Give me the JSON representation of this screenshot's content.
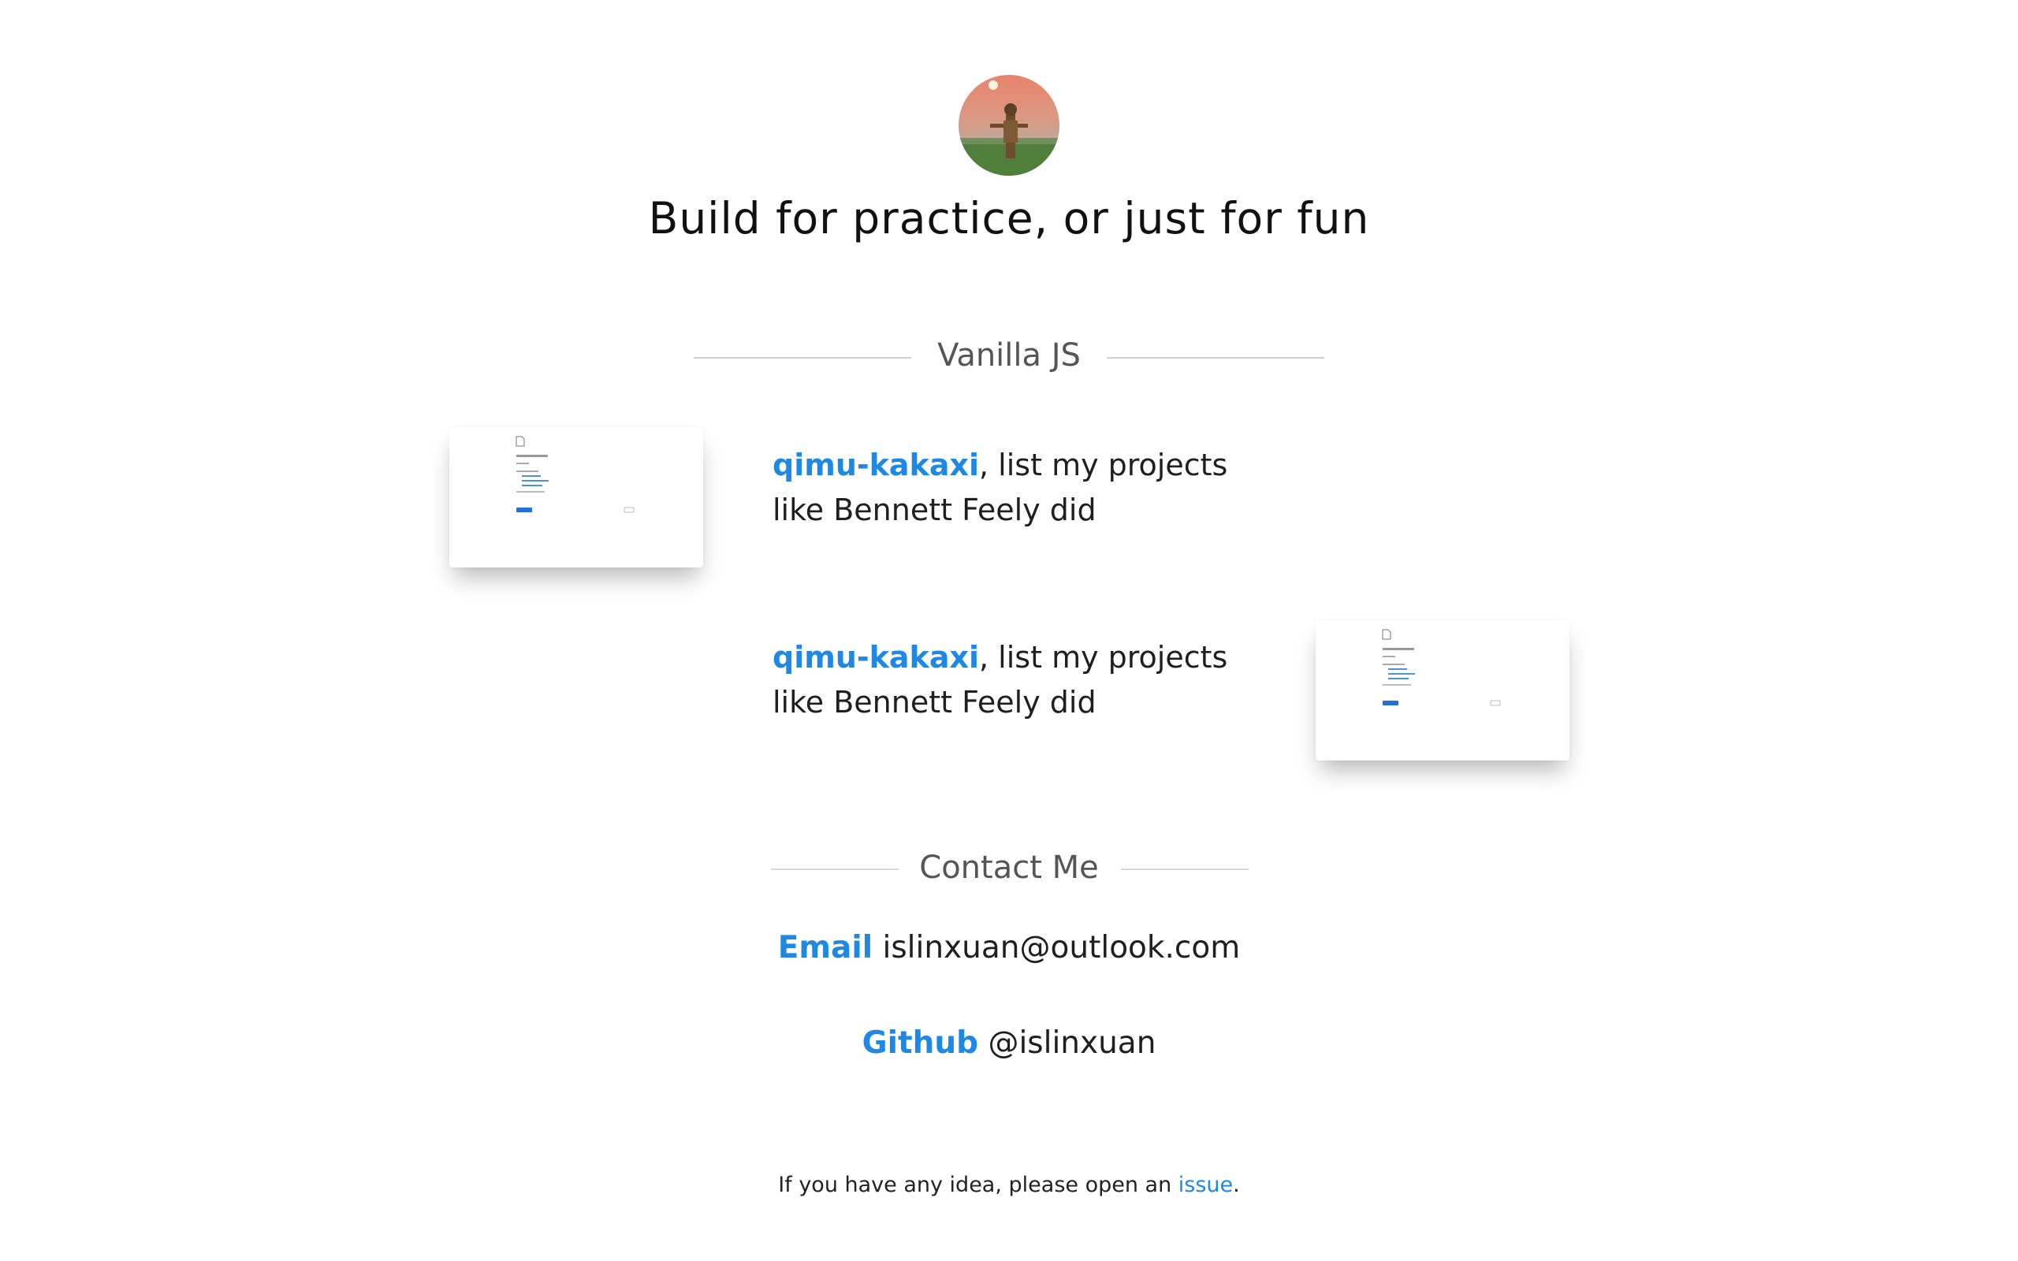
{
  "header": {
    "title": "Build for practice, or just for fun",
    "avatar_alt": "avatar"
  },
  "sections": {
    "vanilla_js": {
      "label": "Vanilla JS"
    },
    "contact": {
      "label": "Contact Me"
    }
  },
  "projects": [
    {
      "link_text": "qimu-kakaxi",
      "description": ", list my projects like Bennett Feely did",
      "thumbnail_icon": "document-preview-icon"
    },
    {
      "link_text": "qimu-kakaxi",
      "description": ", list my projects like Bennett Feely did",
      "thumbnail_icon": "document-preview-icon"
    }
  ],
  "contact": {
    "email_key": "Email",
    "email_value": "islinxuan@outlook.com",
    "github_key": "Github",
    "github_value": "@islinxuan"
  },
  "footer": {
    "text_before": "If you have any idea, please open an ",
    "link_text": "issue",
    "text_after": "."
  },
  "colors": {
    "accent": "#1e88e5",
    "text": "#1f1f1f",
    "muted": "#555555",
    "rule": "#cfcfcf"
  }
}
